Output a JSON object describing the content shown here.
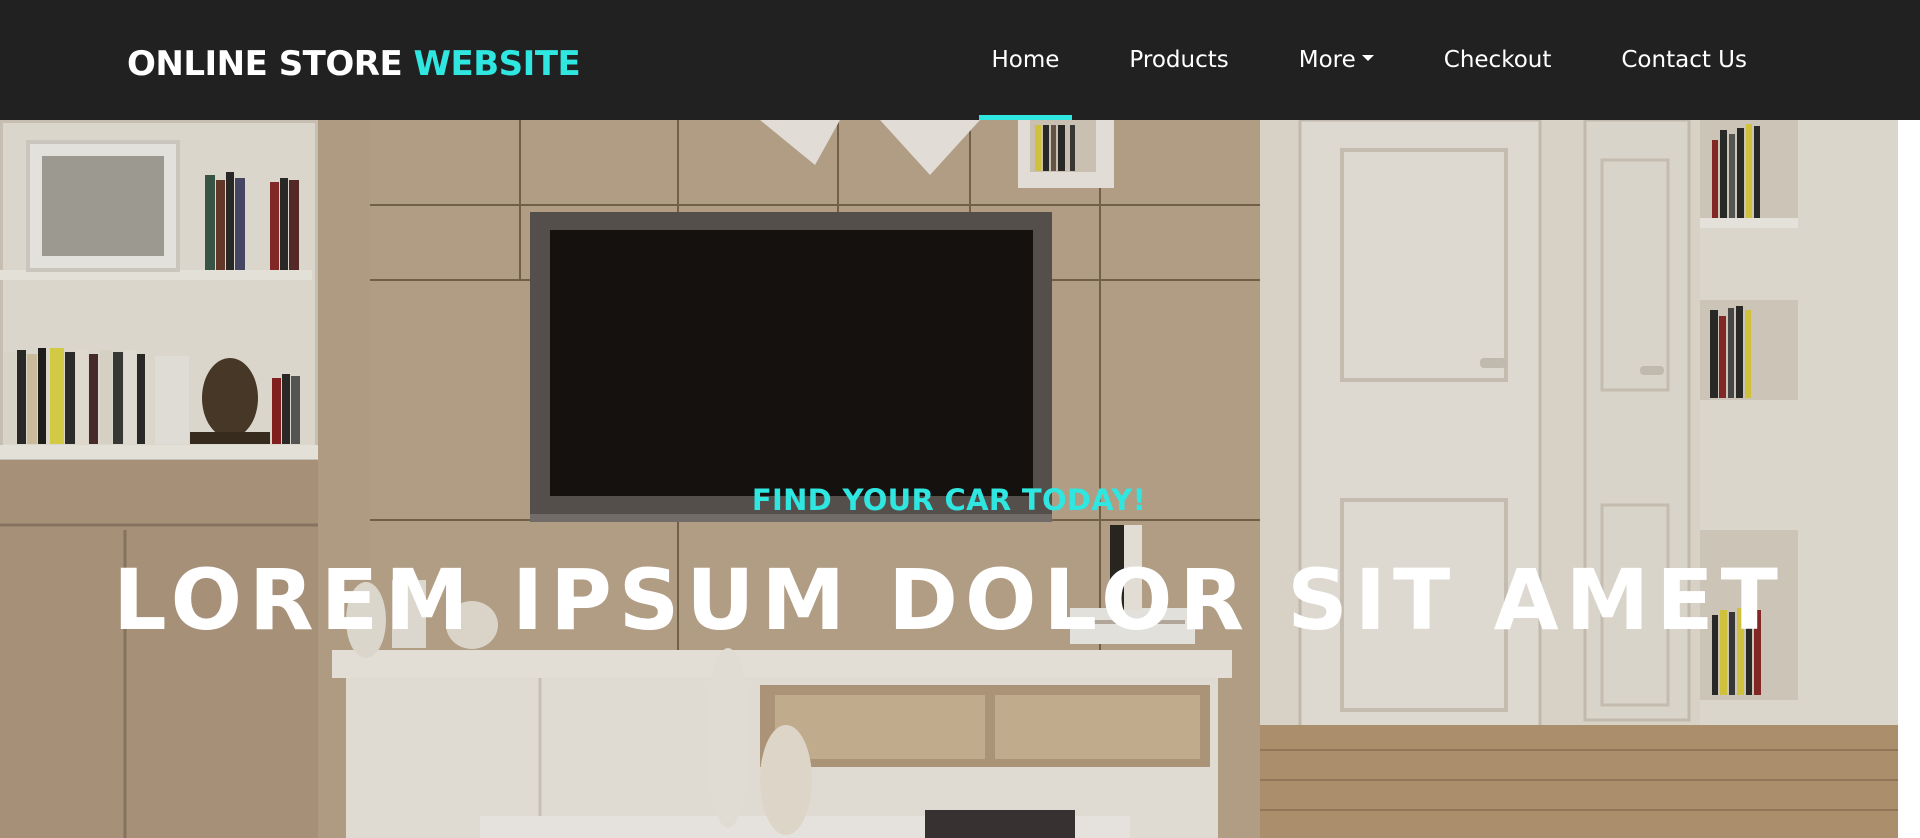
{
  "brand": {
    "text_primary": "ONLINE STORE",
    "text_accent": "WEBSITE",
    "accent_color": "#2fe6e0"
  },
  "nav": {
    "items": [
      {
        "label": "Home",
        "active": true
      },
      {
        "label": "Products",
        "active": false
      },
      {
        "label": "More",
        "active": false,
        "has_dropdown": true,
        "icon": "caret-down-icon"
      },
      {
        "label": "Checkout",
        "active": false
      },
      {
        "label": "Contact Us",
        "active": false
      }
    ],
    "background": "#212121"
  },
  "hero": {
    "tagline": "FIND YOUR CAR TODAY!",
    "title": "LOREM IPSUM DOLOR SIT AMET",
    "image": "living-room-with-tv-wall"
  }
}
